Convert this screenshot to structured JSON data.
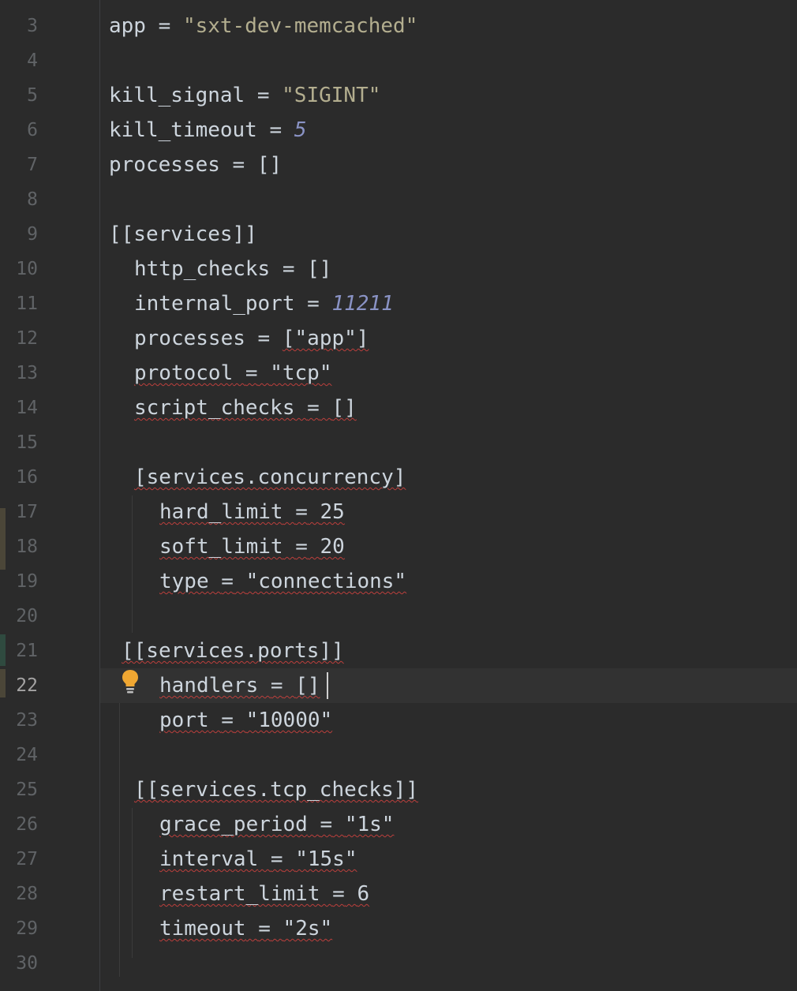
{
  "gutter": {
    "line_numbers": [
      "3",
      "4",
      "5",
      "6",
      "7",
      "8",
      "9",
      "10",
      "11",
      "12",
      "13",
      "14",
      "15",
      "16",
      "17",
      "18",
      "19",
      "20",
      "21",
      "22",
      "23",
      "24",
      "25",
      "26",
      "27",
      "28",
      "29",
      "30"
    ],
    "current_line": "22"
  },
  "code": {
    "l3": {
      "key": "app",
      "op": "=",
      "value": "\"sxt-dev-memcached\""
    },
    "l5": {
      "key": "kill_signal",
      "op": "=",
      "value": "\"SIGINT\""
    },
    "l6": {
      "key": "kill_timeout",
      "op": "=",
      "value": "5"
    },
    "l7": {
      "key": "processes",
      "op": "=",
      "value": "[]"
    },
    "l9": {
      "header": "[[services]]"
    },
    "l10": {
      "key": "http_checks",
      "op": "=",
      "value": "[]"
    },
    "l11": {
      "key": "internal_port",
      "op": "=",
      "value": "11211"
    },
    "l12": {
      "key": "processes",
      "op": "=",
      "value": "[\"app\"]"
    },
    "l13": {
      "key": "protocol",
      "op": "=",
      "value": "\"tcp\""
    },
    "l14": {
      "key": "script_checks",
      "op": "=",
      "value": "[]"
    },
    "l16": {
      "header": "[services.concurrency]"
    },
    "l17": {
      "key": "hard_limit",
      "op": "=",
      "value": "25"
    },
    "l18": {
      "key": "soft_limit",
      "op": "=",
      "value": "20"
    },
    "l19": {
      "key": "type",
      "op": "=",
      "value": "\"connections\""
    },
    "l21": {
      "header": "[[services.ports]]"
    },
    "l22": {
      "key": "handlers",
      "op": "=",
      "value": "[]"
    },
    "l23": {
      "key": "port",
      "op": "=",
      "value": "\"10000\""
    },
    "l25": {
      "header": "[[services.tcp_checks]]"
    },
    "l26": {
      "key": "grace_period",
      "op": "=",
      "value": "\"1s\""
    },
    "l27": {
      "key": "interval",
      "op": "=",
      "value": "\"15s\""
    },
    "l28": {
      "key": "restart_limit",
      "op": "=",
      "value": "6"
    },
    "l29": {
      "key": "timeout",
      "op": "=",
      "value": "\"2s\""
    }
  },
  "icons": {
    "bulb": "lightbulb-icon"
  },
  "colors": {
    "background": "#2b2b2b",
    "string": "#b3ae8f",
    "number": "#8a93c5",
    "error_squiggle": "#bc3f3c",
    "bulb": "#f0a732"
  }
}
